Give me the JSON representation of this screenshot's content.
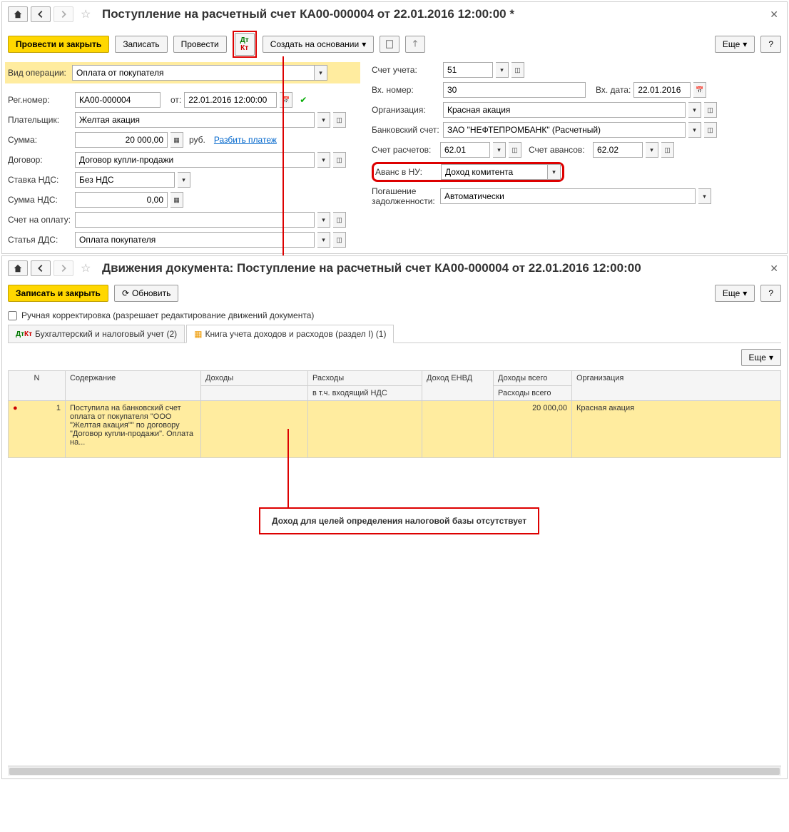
{
  "win1": {
    "title": "Поступление на расчетный счет КА00-000004 от 22.01.2016 12:00:00 *",
    "toolbar": {
      "post_close": "Провести и закрыть",
      "save": "Записать",
      "post": "Провести",
      "create_based": "Создать на основании",
      "more": "Еще",
      "help": "?"
    },
    "fields": {
      "op_type_label": "Вид операции:",
      "op_type_value": "Оплата от покупателя",
      "reg_num_label": "Рег.номер:",
      "reg_num_value": "КА00-000004",
      "from_label": "от:",
      "from_value": "22.01.2016 12:00:00",
      "payer_label": "Плательщик:",
      "payer_value": "Желтая акация",
      "sum_label": "Сумма:",
      "sum_value": "20 000,00",
      "currency": "руб.",
      "split_payment": "Разбить платеж",
      "contract_label": "Договор:",
      "contract_value": "Договор купли-продажи",
      "vat_rate_label": "Ставка НДС:",
      "vat_rate_value": "Без НДС",
      "vat_sum_label": "Сумма НДС:",
      "vat_sum_value": "0,00",
      "invoice_label": "Счет на оплату:",
      "invoice_value": "",
      "dds_label": "Статья ДДС:",
      "dds_value": "Оплата покупателя",
      "account_label": "Счет учета:",
      "account_value": "51",
      "in_num_label": "Вх. номер:",
      "in_num_value": "30",
      "in_date_label": "Вх. дата:",
      "in_date_value": "22.01.2016",
      "org_label": "Организация:",
      "org_value": "Красная акация",
      "bank_label": "Банковский счет:",
      "bank_value": "ЗАО \"НЕФТЕПРОМБАНК\" (Расчетный)",
      "settle_acc_label": "Счет расчетов:",
      "settle_acc_value": "62.01",
      "advance_acc_label": "Счет авансов:",
      "advance_acc_value": "62.02",
      "advance_nu_label": "Аванс в НУ:",
      "advance_nu_value": "Доход комитента",
      "debt_label": "Погашение задолженности:",
      "debt_value": "Автоматически"
    }
  },
  "win2": {
    "title": "Движения документа: Поступление на расчетный счет КА00-000004 от 22.01.2016 12:00:00",
    "toolbar": {
      "save_close": "Записать и закрыть",
      "refresh": "Обновить",
      "more": "Еще",
      "help": "?"
    },
    "manual_edit": "Ручная корректировка (разрешает редактирование движений документа)",
    "tabs": {
      "tab1": "Бухгалтерский и налоговый учет (2)",
      "tab2": "Книга учета доходов и расходов (раздел I) (1)"
    },
    "table_toolbar": {
      "more": "Еще"
    },
    "headers": {
      "n": "N",
      "content": "Содержание",
      "income": "Доходы",
      "expense": "Расходы",
      "envd": "Доход ЕНВД",
      "income_total": "Доходы всего",
      "org": "Организация",
      "incl_vat": "в т.ч. входящий НДС",
      "expense_total": "Расходы всего"
    },
    "row": {
      "n": "1",
      "content": "Поступила на банковский счет оплата от покупателя \"ООО \"Желтая акация\"\" по договору \"Договор купли-продажи\". Оплата на...",
      "income_total": "20 000,00",
      "org": "Красная акация"
    },
    "callout": "Доход для целей определения налоговой базы отсутствует"
  }
}
